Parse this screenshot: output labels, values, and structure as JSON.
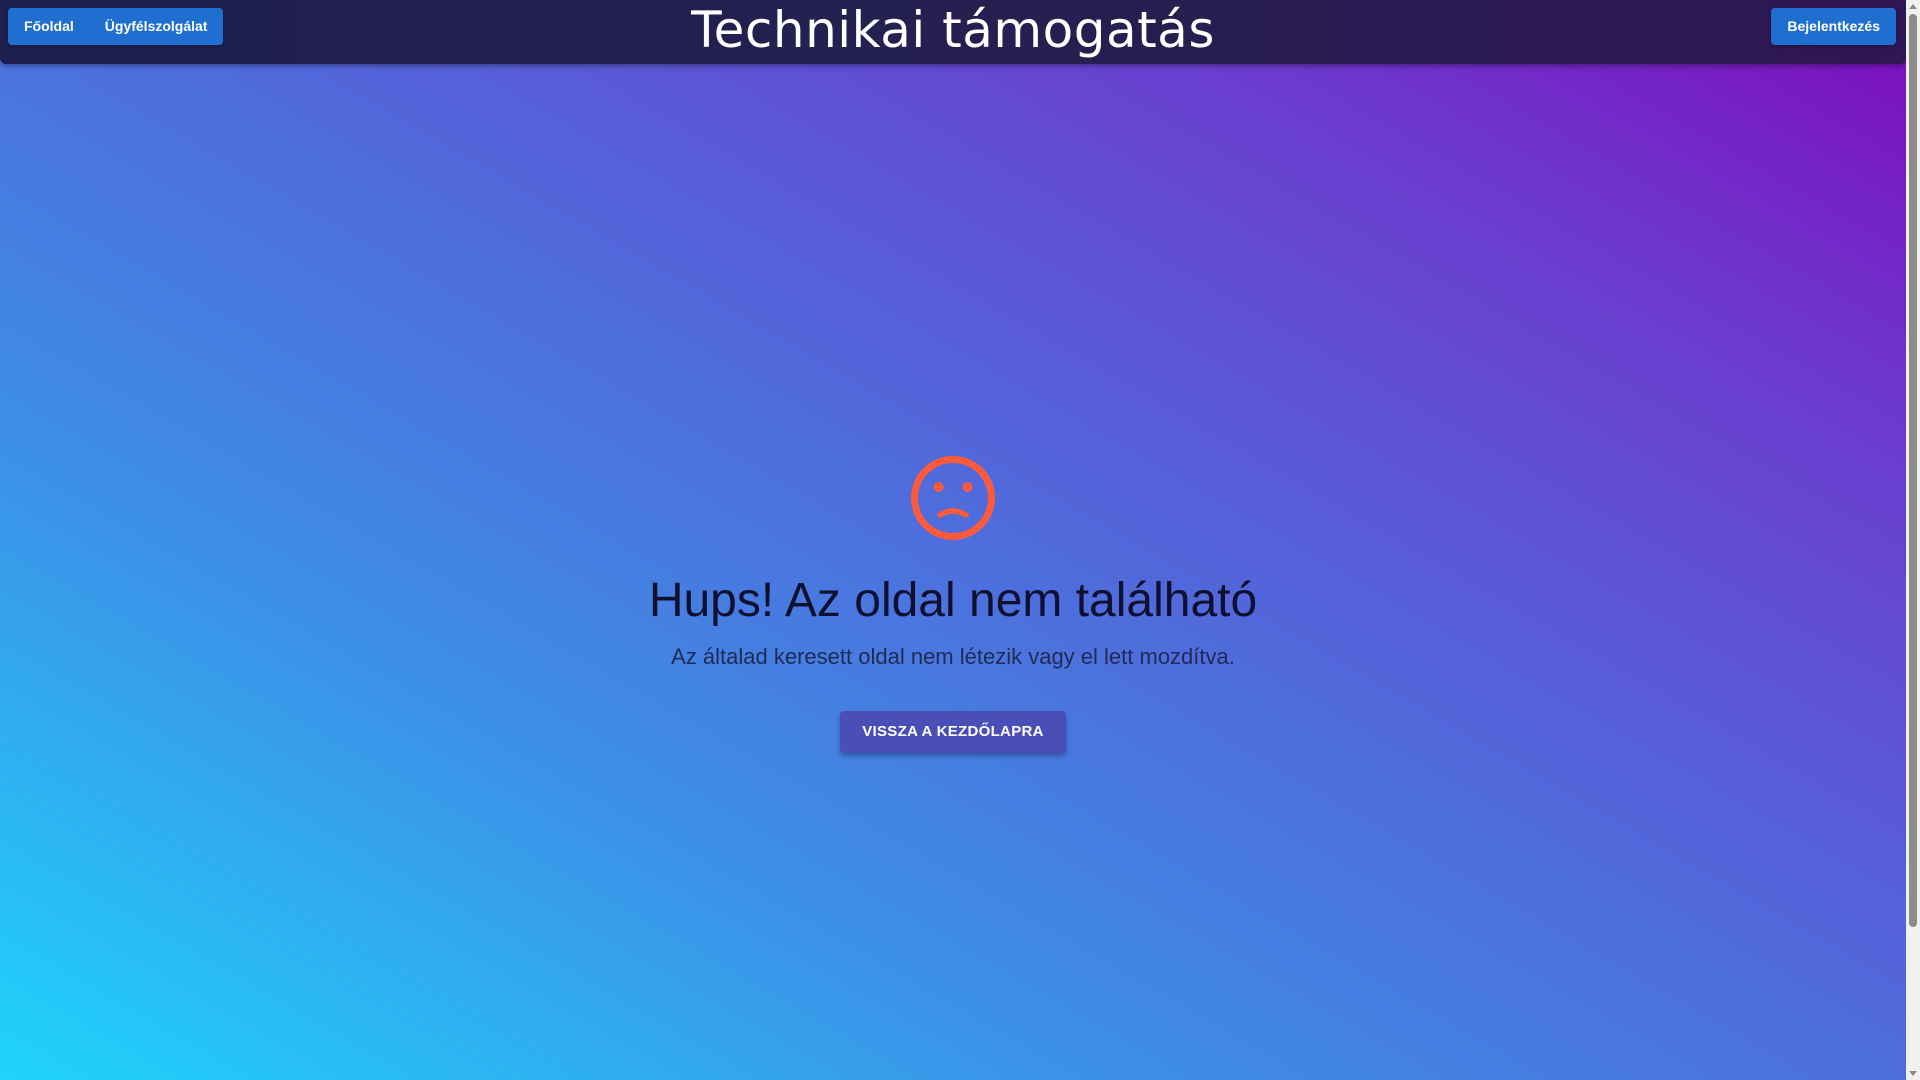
{
  "header": {
    "title": "Technikai támogatás",
    "nav": [
      {
        "label": "Főoldal"
      },
      {
        "label": "Ügyfélszolgálat"
      }
    ],
    "login_label": "Bejelentkezés"
  },
  "error": {
    "icon": "sad-face-icon",
    "title": "Hups! Az oldal nem található",
    "message": "Az általad keresett oldal nem létezik vagy el lett mozdítva.",
    "button_label": "VISSZA A KEZDŐLAPRA"
  },
  "colors": {
    "icon": "#ff5a3c",
    "nav_button": "#1e6fd0",
    "home_button": "#4a4fb8",
    "header_bg": "#221f50",
    "gradient_start": "#1fd4fb",
    "gradient_end": "#7d0bbd"
  }
}
